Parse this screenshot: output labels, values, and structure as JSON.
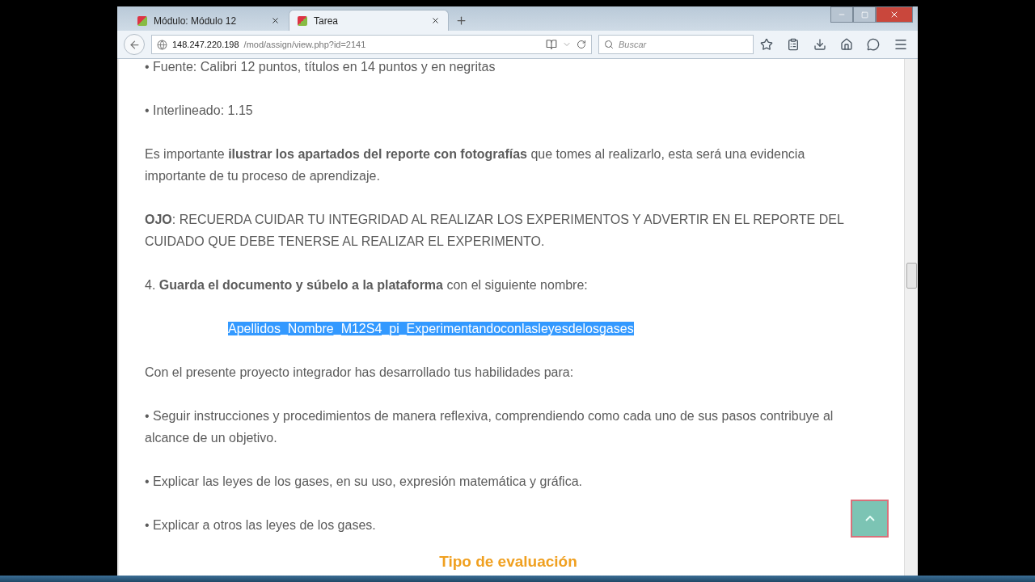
{
  "tabs": [
    {
      "title": "Módulo: Módulo 12",
      "selected": false
    },
    {
      "title": "Tarea",
      "selected": true
    }
  ],
  "address": {
    "host": "148.247.220.198",
    "path": "/mod/assign/view.php?id=2141"
  },
  "search": {
    "placeholder": "Buscar"
  },
  "content": [
    {
      "kind": "para",
      "text": "• Fuente: Calibri 12 puntos, títulos en 14 puntos y en negritas"
    },
    {
      "kind": "para",
      "text": "• Interlineado: 1.15"
    },
    {
      "kind": "para",
      "text": "Es importante **ilustrar los apartados del reporte con fotografías** que tomes al realizarlo, esta será una evidencia importante de tu proceso de aprendizaje."
    },
    {
      "kind": "para",
      "text": "**OJO**: RECUERDA CUIDAR TU INTEGRIDAD AL REALIZAR LOS EXPERIMENTOS Y ADVERTIR EN EL REPORTE DEL CUIDADO QUE DEBE TENERSE AL REALIZAR EL EXPERIMENTO."
    },
    {
      "kind": "para",
      "text": "4. **Guarda el documento y súbelo a la plataforma** con el siguiente nombre:"
    },
    {
      "kind": "highlight",
      "text": "Apellidos_Nombre_M12S4_pi_Experimentandoconlasleyesdelosgases"
    },
    {
      "kind": "para",
      "text": "Con el presente proyecto integrador has desarrollado tus habilidades para:"
    },
    {
      "kind": "para",
      "text": "• Seguir instrucciones y procedimientos de manera reflexiva, comprendiendo como cada uno de sus pasos contribuye al alcance de un objetivo."
    },
    {
      "kind": "para",
      "text": "• Explicar las leyes de los gases, en su uso, expresión matemática y gráfica."
    },
    {
      "kind": "para",
      "text": "• Explicar a otros las leyes de los gases."
    },
    {
      "kind": "heading",
      "text": "Tipo de evaluación"
    }
  ]
}
